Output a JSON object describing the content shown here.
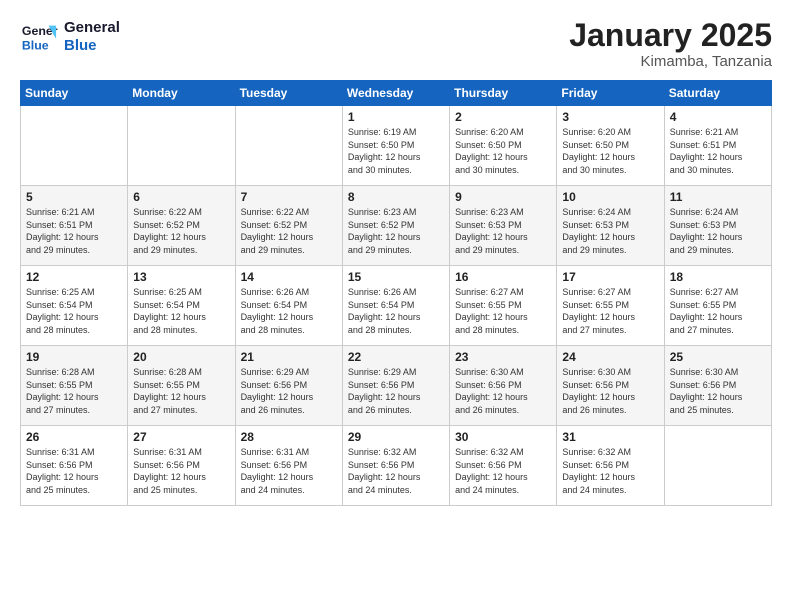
{
  "header": {
    "logo_line1": "General",
    "logo_line2": "Blue",
    "title": "January 2025",
    "subtitle": "Kimamba, Tanzania"
  },
  "days_of_week": [
    "Sunday",
    "Monday",
    "Tuesday",
    "Wednesday",
    "Thursday",
    "Friday",
    "Saturday"
  ],
  "weeks": [
    [
      {
        "day": "",
        "info": ""
      },
      {
        "day": "",
        "info": ""
      },
      {
        "day": "",
        "info": ""
      },
      {
        "day": "1",
        "info": "Sunrise: 6:19 AM\nSunset: 6:50 PM\nDaylight: 12 hours\nand 30 minutes."
      },
      {
        "day": "2",
        "info": "Sunrise: 6:20 AM\nSunset: 6:50 PM\nDaylight: 12 hours\nand 30 minutes."
      },
      {
        "day": "3",
        "info": "Sunrise: 6:20 AM\nSunset: 6:50 PM\nDaylight: 12 hours\nand 30 minutes."
      },
      {
        "day": "4",
        "info": "Sunrise: 6:21 AM\nSunset: 6:51 PM\nDaylight: 12 hours\nand 30 minutes."
      }
    ],
    [
      {
        "day": "5",
        "info": "Sunrise: 6:21 AM\nSunset: 6:51 PM\nDaylight: 12 hours\nand 29 minutes."
      },
      {
        "day": "6",
        "info": "Sunrise: 6:22 AM\nSunset: 6:52 PM\nDaylight: 12 hours\nand 29 minutes."
      },
      {
        "day": "7",
        "info": "Sunrise: 6:22 AM\nSunset: 6:52 PM\nDaylight: 12 hours\nand 29 minutes."
      },
      {
        "day": "8",
        "info": "Sunrise: 6:23 AM\nSunset: 6:52 PM\nDaylight: 12 hours\nand 29 minutes."
      },
      {
        "day": "9",
        "info": "Sunrise: 6:23 AM\nSunset: 6:53 PM\nDaylight: 12 hours\nand 29 minutes."
      },
      {
        "day": "10",
        "info": "Sunrise: 6:24 AM\nSunset: 6:53 PM\nDaylight: 12 hours\nand 29 minutes."
      },
      {
        "day": "11",
        "info": "Sunrise: 6:24 AM\nSunset: 6:53 PM\nDaylight: 12 hours\nand 29 minutes."
      }
    ],
    [
      {
        "day": "12",
        "info": "Sunrise: 6:25 AM\nSunset: 6:54 PM\nDaylight: 12 hours\nand 28 minutes."
      },
      {
        "day": "13",
        "info": "Sunrise: 6:25 AM\nSunset: 6:54 PM\nDaylight: 12 hours\nand 28 minutes."
      },
      {
        "day": "14",
        "info": "Sunrise: 6:26 AM\nSunset: 6:54 PM\nDaylight: 12 hours\nand 28 minutes."
      },
      {
        "day": "15",
        "info": "Sunrise: 6:26 AM\nSunset: 6:54 PM\nDaylight: 12 hours\nand 28 minutes."
      },
      {
        "day": "16",
        "info": "Sunrise: 6:27 AM\nSunset: 6:55 PM\nDaylight: 12 hours\nand 28 minutes."
      },
      {
        "day": "17",
        "info": "Sunrise: 6:27 AM\nSunset: 6:55 PM\nDaylight: 12 hours\nand 27 minutes."
      },
      {
        "day": "18",
        "info": "Sunrise: 6:27 AM\nSunset: 6:55 PM\nDaylight: 12 hours\nand 27 minutes."
      }
    ],
    [
      {
        "day": "19",
        "info": "Sunrise: 6:28 AM\nSunset: 6:55 PM\nDaylight: 12 hours\nand 27 minutes."
      },
      {
        "day": "20",
        "info": "Sunrise: 6:28 AM\nSunset: 6:55 PM\nDaylight: 12 hours\nand 27 minutes."
      },
      {
        "day": "21",
        "info": "Sunrise: 6:29 AM\nSunset: 6:56 PM\nDaylight: 12 hours\nand 26 minutes."
      },
      {
        "day": "22",
        "info": "Sunrise: 6:29 AM\nSunset: 6:56 PM\nDaylight: 12 hours\nand 26 minutes."
      },
      {
        "day": "23",
        "info": "Sunrise: 6:30 AM\nSunset: 6:56 PM\nDaylight: 12 hours\nand 26 minutes."
      },
      {
        "day": "24",
        "info": "Sunrise: 6:30 AM\nSunset: 6:56 PM\nDaylight: 12 hours\nand 26 minutes."
      },
      {
        "day": "25",
        "info": "Sunrise: 6:30 AM\nSunset: 6:56 PM\nDaylight: 12 hours\nand 25 minutes."
      }
    ],
    [
      {
        "day": "26",
        "info": "Sunrise: 6:31 AM\nSunset: 6:56 PM\nDaylight: 12 hours\nand 25 minutes."
      },
      {
        "day": "27",
        "info": "Sunrise: 6:31 AM\nSunset: 6:56 PM\nDaylight: 12 hours\nand 25 minutes."
      },
      {
        "day": "28",
        "info": "Sunrise: 6:31 AM\nSunset: 6:56 PM\nDaylight: 12 hours\nand 24 minutes."
      },
      {
        "day": "29",
        "info": "Sunrise: 6:32 AM\nSunset: 6:56 PM\nDaylight: 12 hours\nand 24 minutes."
      },
      {
        "day": "30",
        "info": "Sunrise: 6:32 AM\nSunset: 6:56 PM\nDaylight: 12 hours\nand 24 minutes."
      },
      {
        "day": "31",
        "info": "Sunrise: 6:32 AM\nSunset: 6:56 PM\nDaylight: 12 hours\nand 24 minutes."
      },
      {
        "day": "",
        "info": ""
      }
    ]
  ]
}
